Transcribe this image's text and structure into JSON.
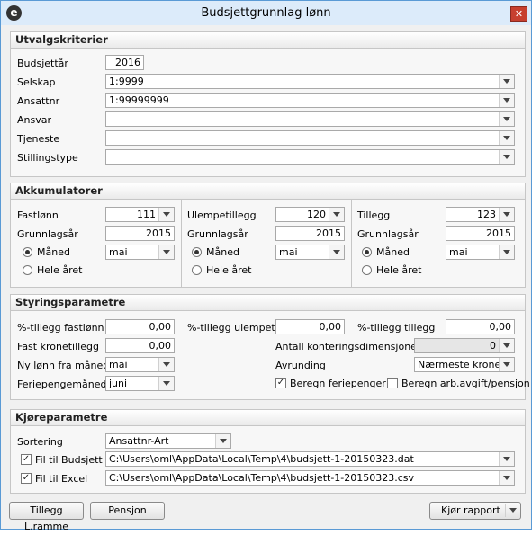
{
  "window": {
    "title": "Budsjettgrunnlag lønn",
    "icon": "e",
    "close_label": "✕"
  },
  "utvalg": {
    "heading": "Utvalgskriterier",
    "budsjettar_label": "Budsjettår",
    "budsjettar_value": "2016",
    "selskap_label": "Selskap",
    "selskap_value": "1:9999",
    "ansattnr_label": "Ansattnr",
    "ansattnr_value": "1:99999999",
    "ansvar_label": "Ansvar",
    "ansvar_value": "",
    "tjeneste_label": "Tjeneste",
    "tjeneste_value": "",
    "stillingstype_label": "Stillingstype",
    "stillingstype_value": ""
  },
  "akkumulatorer": {
    "heading": "Akkumulatorer",
    "fastlonn": {
      "label": "Fastlønn",
      "value": "111",
      "grunnlag_label": "Grunnlagsår",
      "grunnlag_value": "2015",
      "maned_label": "Måned",
      "maned_value": "mai",
      "hele_label": "Hele året",
      "selected": "maned"
    },
    "ulempe": {
      "label": "Ulempetillegg",
      "value": "120",
      "grunnlag_label": "Grunnlagsår",
      "grunnlag_value": "2015",
      "maned_label": "Måned",
      "maned_value": "mai",
      "hele_label": "Hele året",
      "selected": "maned"
    },
    "tillegg": {
      "label": "Tillegg",
      "value": "123",
      "grunnlag_label": "Grunnlagsår",
      "grunnlag_value": "2015",
      "maned_label": "Måned",
      "maned_value": "mai",
      "hele_label": "Hele året",
      "selected": "maned"
    }
  },
  "styring": {
    "heading": "Styringsparametre",
    "tillegg_fastlonn_label": "%-tillegg fastlønn",
    "tillegg_fastlonn_value": "0,00",
    "tillegg_ulempe_label": "%-tillegg ulempetill.",
    "tillegg_ulempe_value": "0,00",
    "tillegg_tillegg_label": "%-tillegg tillegg",
    "tillegg_tillegg_value": "0,00",
    "fast_krone_label": "Fast kronetillegg",
    "fast_krone_value": "0,00",
    "antall_label": "Antall konteringsdimensjoner",
    "antall_value": "0",
    "ny_lonn_label": "Ny lønn fra måned",
    "ny_lonn_value": "mai",
    "avrunding_label": "Avrunding",
    "avrunding_value": "Nærmeste krone",
    "feriepenge_label": "Feriepengemåned",
    "feriepenge_value": "juni",
    "beregn_ferie_label": "Beregn feriepenger",
    "beregn_ferie_checked": true,
    "beregn_arb_label": "Beregn arb.avgift/pensjon",
    "beregn_arb_checked": false
  },
  "kjore": {
    "heading": "Kjøreparametre",
    "sortering_label": "Sortering",
    "sortering_value": "Ansattnr-Art",
    "fil_budsjett_label": "Fil til Budsjett",
    "fil_budsjett_checked": true,
    "fil_budsjett_value": "C:\\Users\\oml\\AppData\\Local\\Temp\\4\\budsjett-1-20150323.dat",
    "fil_excel_label": "Fil til Excel",
    "fil_excel_checked": true,
    "fil_excel_value": "C:\\Users\\oml\\AppData\\Local\\Temp\\4\\budsjett-1-20150323.csv"
  },
  "buttons": {
    "tillegg_ramme": "Tillegg L.ramme",
    "pensjon": "Pensjon",
    "kjor_rapport": "Kjør rapport"
  }
}
